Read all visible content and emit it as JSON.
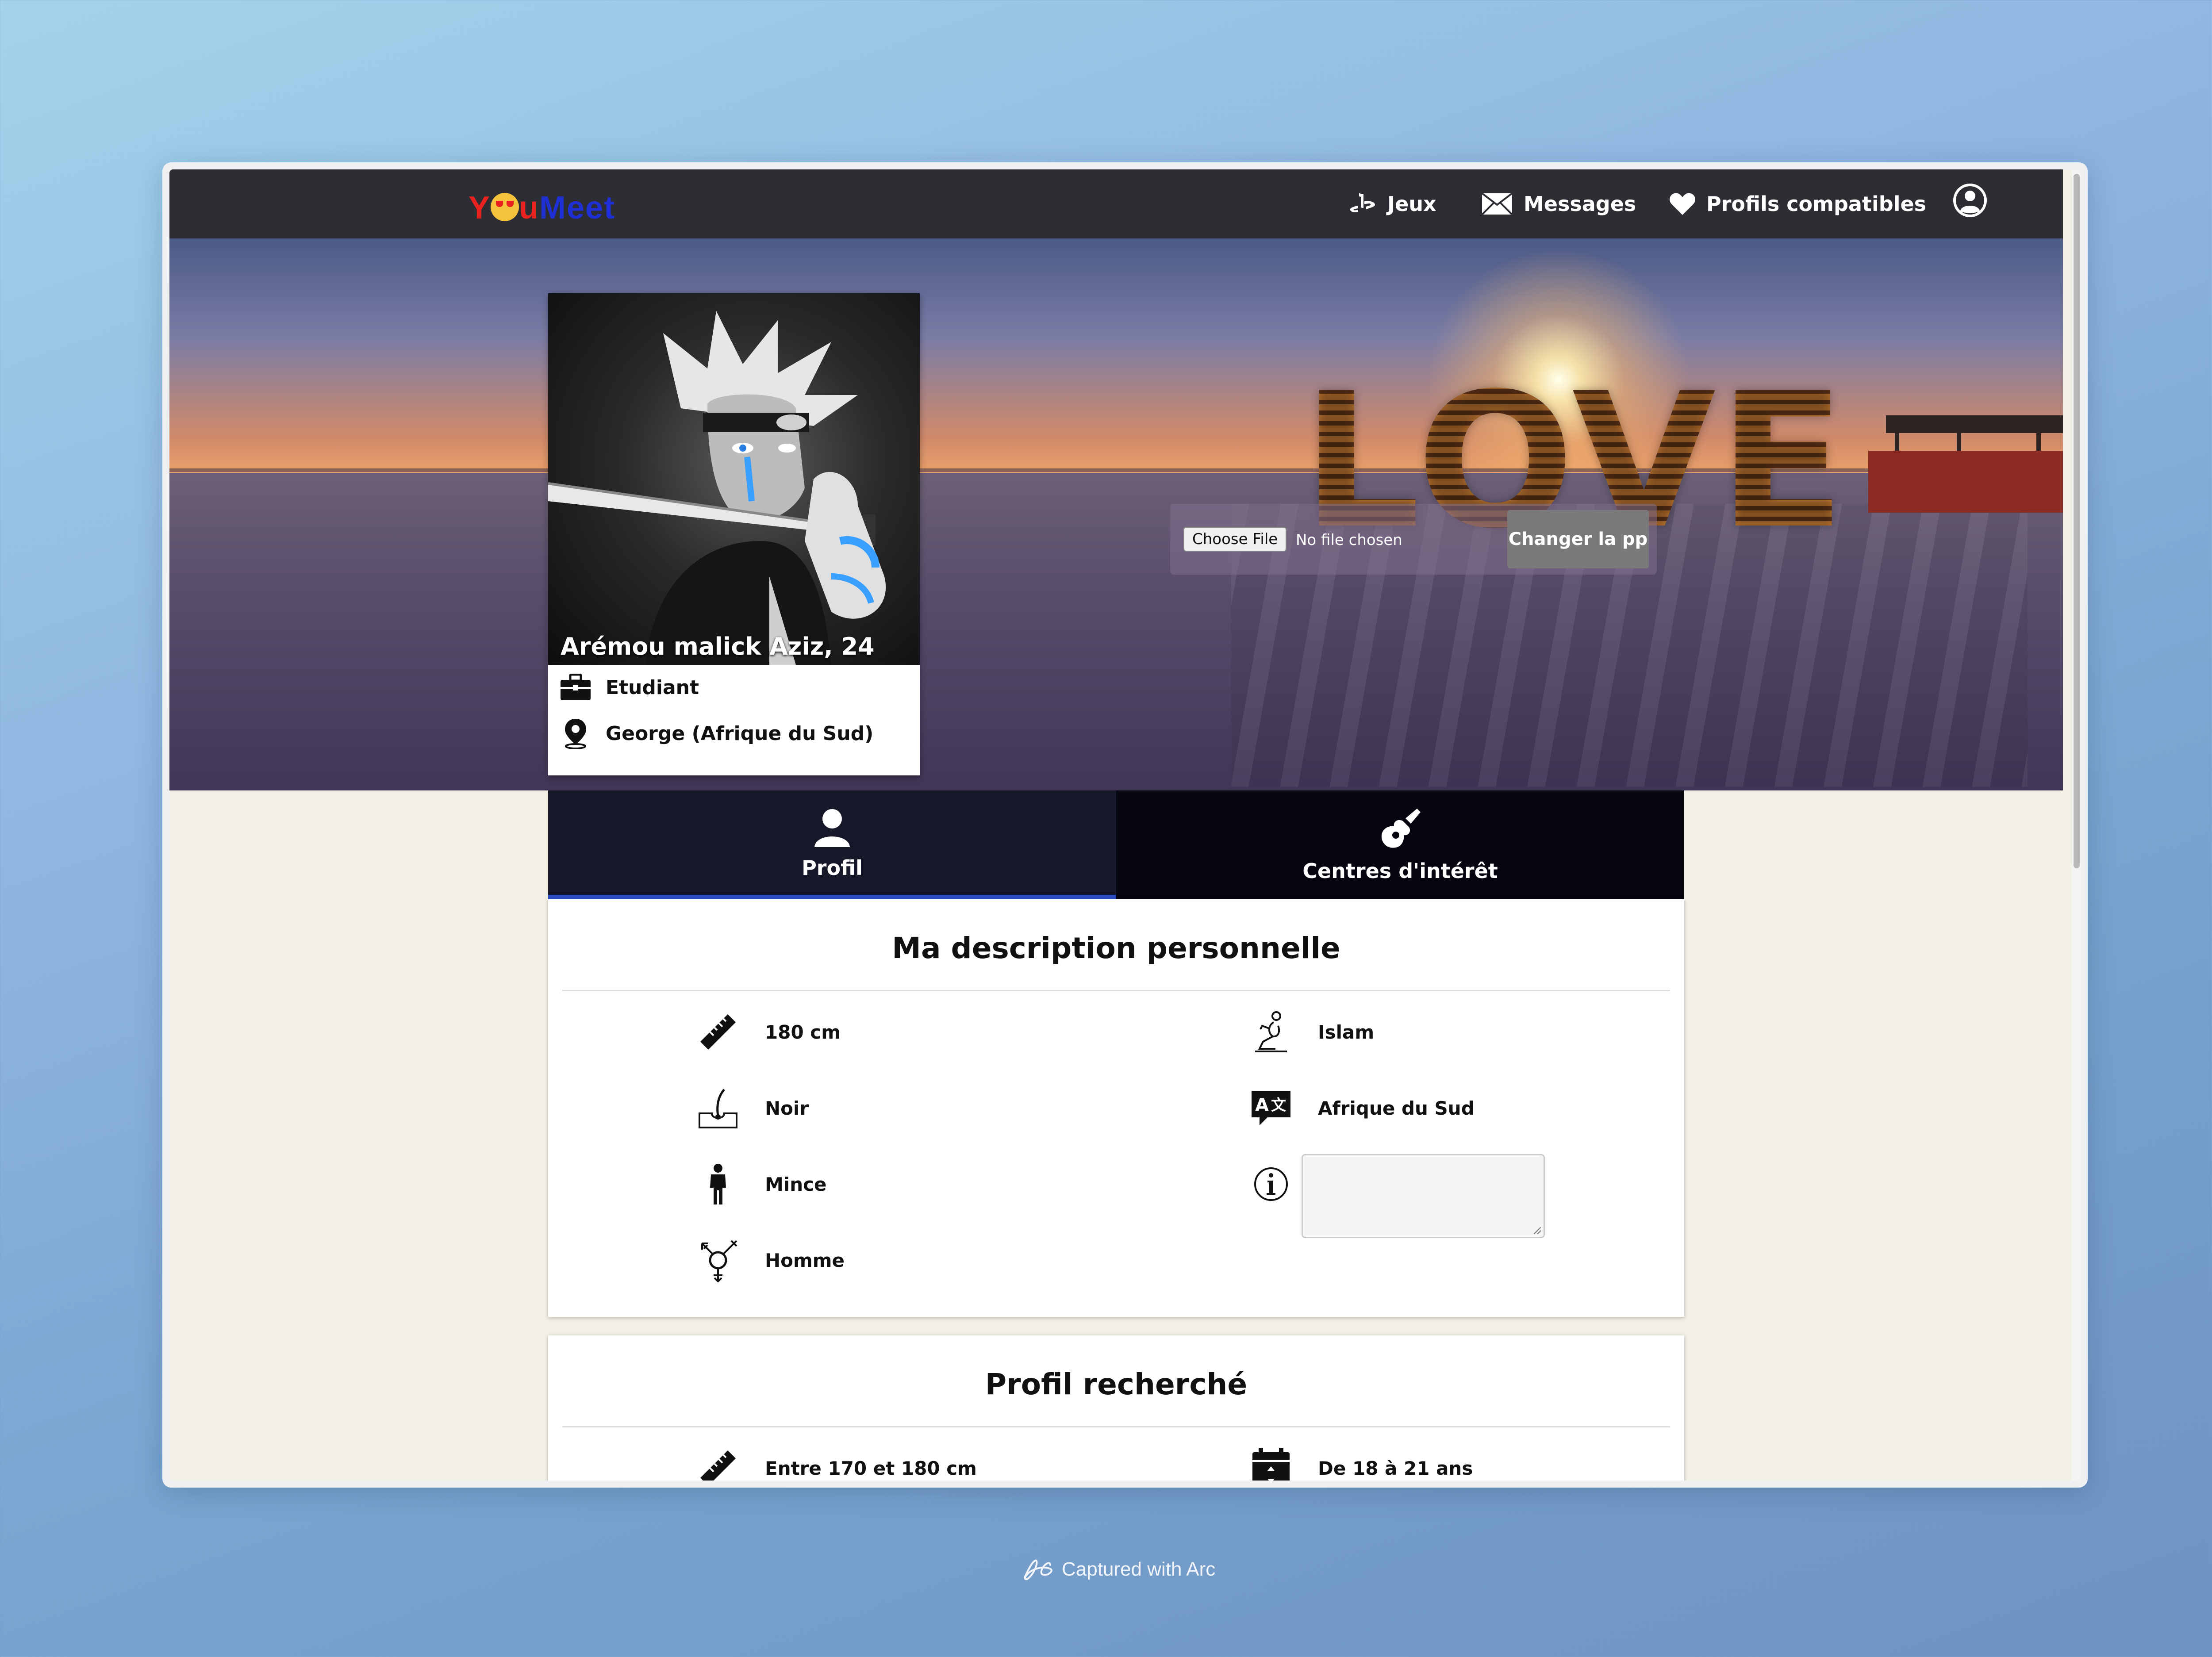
{
  "nav": {
    "logo": {
      "y": "Y",
      "u": "u",
      "meet": "Meet"
    },
    "items": [
      {
        "label": "Jeux",
        "icon": "gamepad-icon"
      },
      {
        "label": "Messages",
        "icon": "envelope-icon"
      },
      {
        "label": "Profils compatibles",
        "icon": "heart-icon"
      }
    ],
    "user_icon": "user-circle-icon"
  },
  "banner": {
    "love_text": "LOVE",
    "upload": {
      "choose_label": "Choose File",
      "no_file": "No file chosen",
      "change_label": "Changer la pp"
    }
  },
  "profile": {
    "name_age": "Arémou malick Aziz, 24",
    "occupation": "Etudiant",
    "location": "George (Afrique du Sud)"
  },
  "tabs": [
    {
      "label": "Profil",
      "icon": "person-icon",
      "active": true
    },
    {
      "label": "Centres d'intérêt",
      "icon": "guitar-icon",
      "active": false
    }
  ],
  "description": {
    "title": "Ma description personnelle",
    "left": [
      {
        "icon": "ruler-icon",
        "value": "180 cm"
      },
      {
        "icon": "hair-icon",
        "value": "Noir"
      },
      {
        "icon": "body-icon",
        "value": "Mince"
      },
      {
        "icon": "gender-icon",
        "value": "Homme"
      }
    ],
    "right": [
      {
        "icon": "prayer-icon",
        "value": "Islam"
      },
      {
        "icon": "language-icon",
        "value": "Afrique du Sud"
      },
      {
        "icon": "info-icon",
        "value": ""
      }
    ]
  },
  "search": {
    "title": "Profil recherché",
    "height": "Entre 170 et 180 cm",
    "age": "De 18 à 21 ans"
  },
  "footer": {
    "captured": "Captured with Arc"
  },
  "colors": {
    "navbar": "#2d2e34",
    "tab_active": "#16182a",
    "tab_inactive": "#04050f",
    "tab_accent": "#2c4cc0",
    "page_bg": "#f2f0e5"
  }
}
